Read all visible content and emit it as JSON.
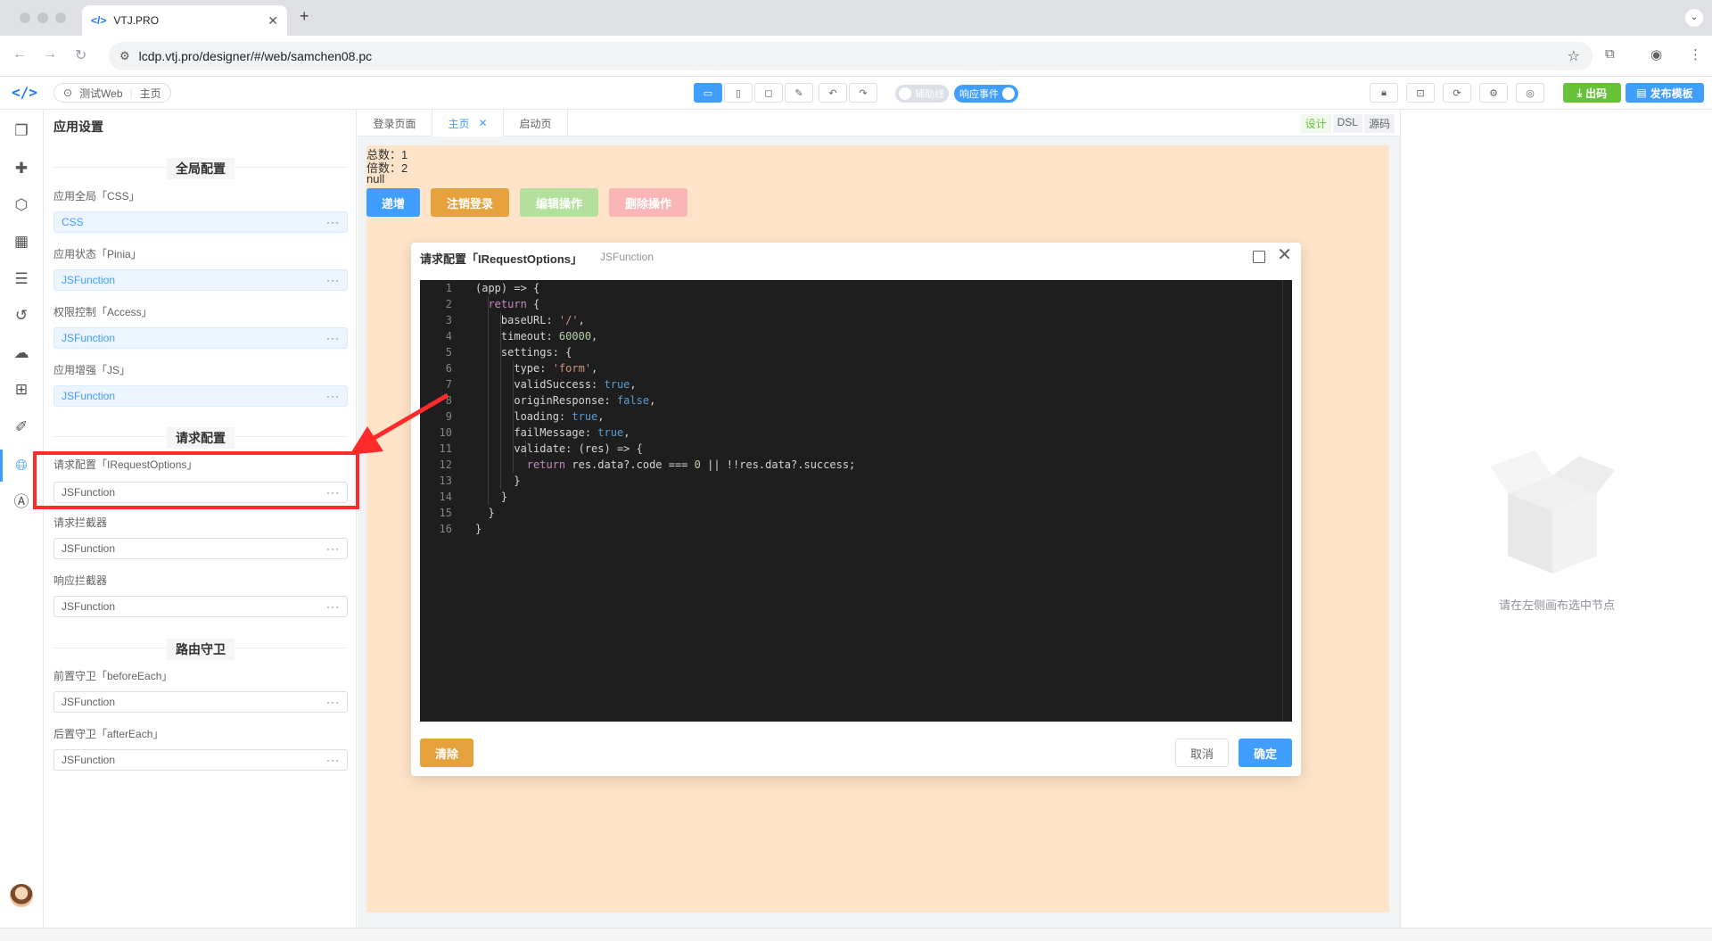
{
  "browser": {
    "tab_title": "VTJ.PRO",
    "url": "lcdp.vtj.pro/designer/#/web/samchen08.pc"
  },
  "toolbar": {
    "project_name": "测试Web",
    "page_name": "主页",
    "switch_guides": "辅助线",
    "switch_events": "响应事件",
    "btn_export": "出码",
    "btn_publish": "发布模板"
  },
  "settings": {
    "title": "应用设置",
    "sections": {
      "global": "全局配置",
      "request": "请求配置",
      "router": "路由守卫"
    },
    "fields": [
      {
        "label": "应用全局「CSS」",
        "value": "CSS"
      },
      {
        "label": "应用状态「Pinia」",
        "value": "JSFunction"
      },
      {
        "label": "权限控制「Access」",
        "value": "JSFunction"
      },
      {
        "label": "应用增强「JS」",
        "value": "JSFunction"
      },
      {
        "label": "请求配置「IRequestOptions」",
        "value": "JSFunction"
      },
      {
        "label": "请求拦截器",
        "value": "JSFunction"
      },
      {
        "label": "响应拦截器",
        "value": "JSFunction"
      },
      {
        "label": "前置守卫「beforeEach」",
        "value": "JSFunction"
      },
      {
        "label": "后置守卫「afterEach」",
        "value": "JSFunction"
      }
    ],
    "more": "···"
  },
  "doc_tabs": [
    {
      "label": "登录页面"
    },
    {
      "label": "主页"
    },
    {
      "label": "启动页"
    }
  ],
  "modes": [
    "设计",
    "DSL",
    "源码"
  ],
  "preview": {
    "total": "总数：1",
    "multiple": "倍数：2",
    "null_text": "null",
    "buttons": [
      "递增",
      "注销登录",
      "编辑操作",
      "删除操作"
    ]
  },
  "right_panel": {
    "empty_text": "请在左侧画布选中节点"
  },
  "dialog": {
    "title": "请求配置「IRequestOptions」",
    "subtitle": "JSFunction",
    "btn_clear": "清除",
    "btn_cancel": "取消",
    "btn_ok": "确定",
    "code_lines": [
      "(app) => {",
      "  return {",
      "    baseURL: '/',",
      "    timeout: 60000,",
      "    settings: {",
      "      type: 'form',",
      "      validSuccess: true,",
      "      originResponse: false,",
      "      loading: true,",
      "      failMessage: true,",
      "      validate: (res) => {",
      "        return res.data?.code === 0 || !!res.data?.success;",
      "      }",
      "    }",
      "  }",
      "}"
    ]
  },
  "colors": {
    "primary": "#409eff",
    "success": "#67c23a",
    "warning": "#e6a23c",
    "canvas_bg": "#ffe4c9",
    "annotation": "#ff2a2a"
  }
}
